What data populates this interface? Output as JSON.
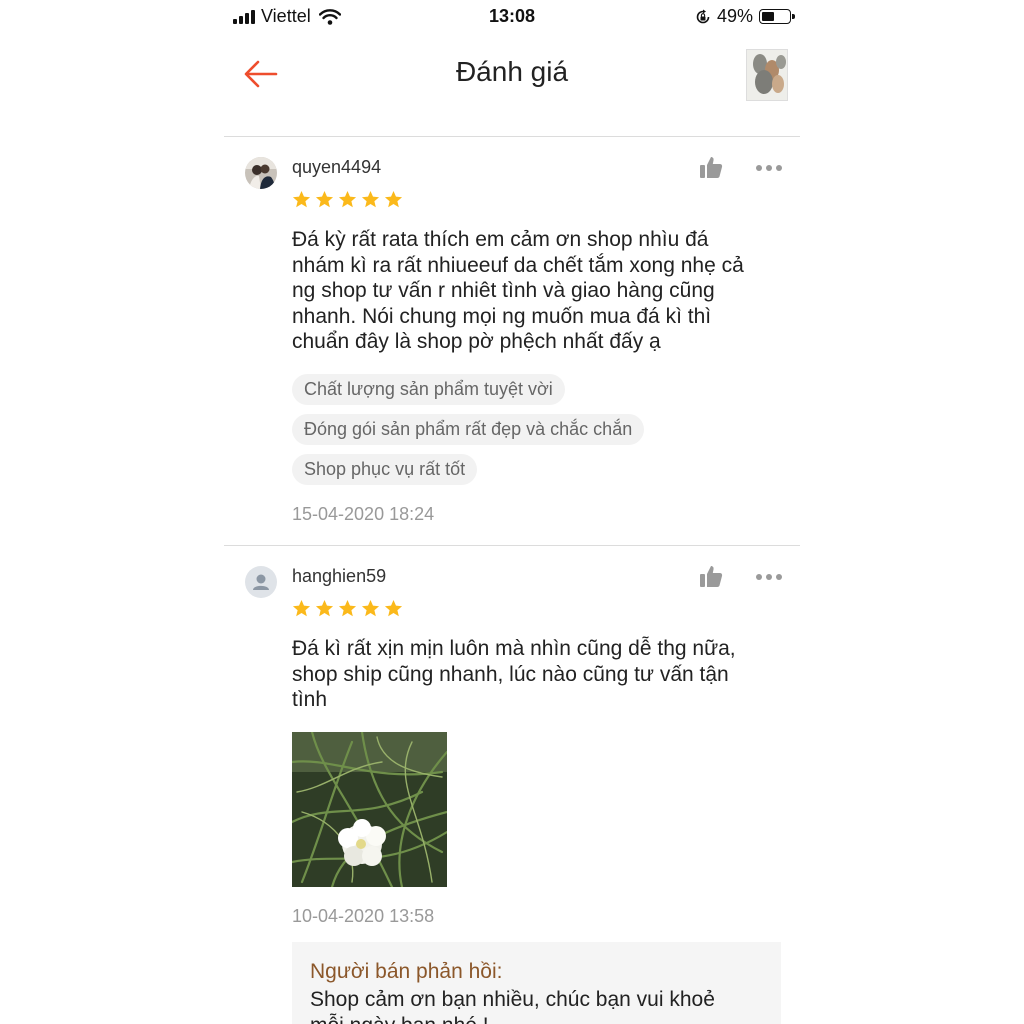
{
  "status_bar": {
    "carrier": "Viettel",
    "time": "13:08",
    "battery": "49%",
    "battery_level": 0.49
  },
  "header": {
    "title": "Đánh giá",
    "back_icon": "arrow-left-icon",
    "product_thumbnail": "product-thumbnail"
  },
  "colors": {
    "accent": "#ee4d2d",
    "star": "#fbb91b",
    "reply_title": "#8b572a"
  },
  "reviews": [
    {
      "username": "quyen4494",
      "rating": 5,
      "content": "Đá kỳ rất rata thích em cảm ơn shop nhìu đá\nnhám kì ra rất nhiueeuf da chết tắm xong nhẹ cả\nng shop tư vấn r nhiêt tình và giao hàng cũng\nnhanh. Nói chung mọi ng muốn mua đá kì thì\nchuẩn đây là shop pờ phệch nhất đấy ạ",
      "tags": [
        "Chất lượng sản phẩm tuyệt vời",
        "Đóng gói sản phẩm rất đẹp và chắc chắn",
        "Shop phục vụ rất tốt"
      ],
      "date": "15-04-2020 18:24"
    },
    {
      "username": "hanghien59",
      "rating": 5,
      "content": "Đá kì rất xịn mịn luôn mà nhìn cũng dễ thg nữa,\nshop ship cũng nhanh, lúc nào cũng tư vấn tận\ntình",
      "date": "10-04-2020 13:58",
      "seller_reply": {
        "title": "Người bán phản hồi:",
        "text": "Shop cảm ơn bạn nhiều, chúc bạn vui khoẻ\nmỗi ngày bạn nhé !"
      }
    }
  ]
}
